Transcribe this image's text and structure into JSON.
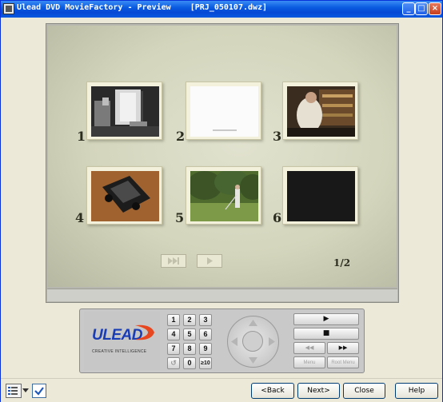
{
  "window": {
    "title": "Ulead DVD MovieFactory - Preview",
    "project": "[PRJ_050107.dwz]",
    "controls": {
      "minimize": "_",
      "maximize": "□",
      "close": "×"
    }
  },
  "preview": {
    "thumbnails": [
      {
        "number": "1",
        "icon": "scene-kitchen-icon",
        "caption": ""
      },
      {
        "number": "2",
        "icon": "scene-blank-icon",
        "caption": ""
      },
      {
        "number": "3",
        "icon": "scene-shop-icon",
        "caption": ""
      },
      {
        "number": "4",
        "icon": "scene-car-icon",
        "caption": ""
      },
      {
        "number": "5",
        "icon": "scene-golf-icon",
        "caption": ""
      },
      {
        "number": "6",
        "icon": "scene-black-icon",
        "caption": ""
      }
    ],
    "page_counter": "1/2",
    "nav": {
      "next_page_icon": "skip-forward-icon",
      "play_icon": "play-icon"
    }
  },
  "remote": {
    "logo": "ULEAD",
    "tagline": "CREATIVE INTELLIGENCE",
    "keypad": [
      "1",
      "2",
      "3",
      "4",
      "5",
      "6",
      "7",
      "8",
      "9",
      "↺",
      "0",
      "≥10"
    ],
    "playback": {
      "play": "▶",
      "stop": "■",
      "rewind": "◀◀",
      "forward": "▶▶",
      "menu": "Menu",
      "root_menu": "Root Menu"
    }
  },
  "footer": {
    "back": "<Back",
    "next": "Next>",
    "close": "Close",
    "help": "Help"
  }
}
